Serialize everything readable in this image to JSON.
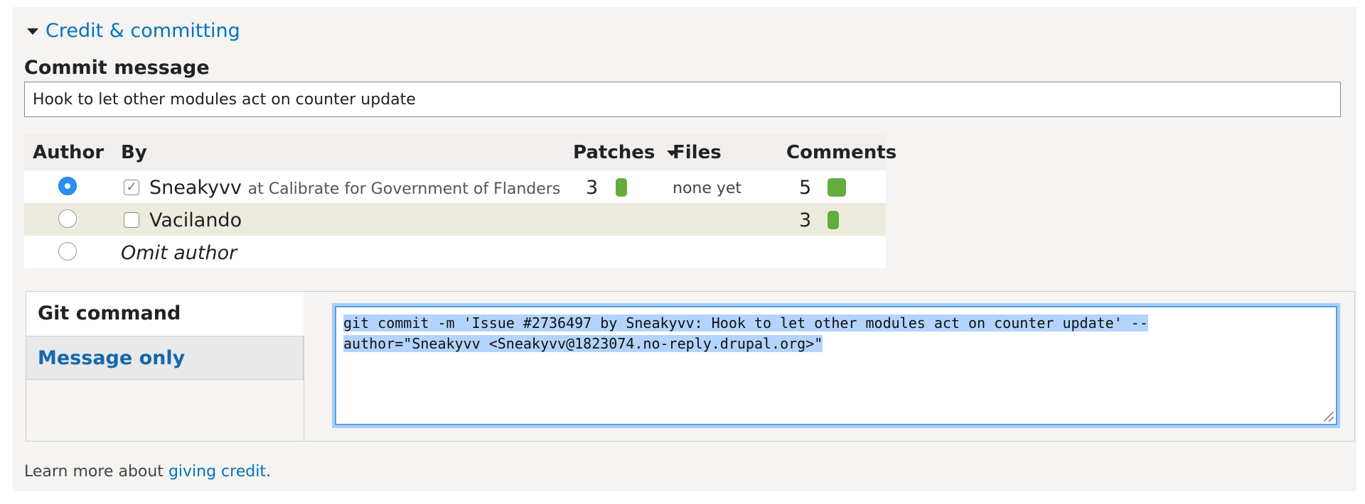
{
  "section": {
    "summary_label": "Credit & committing"
  },
  "commit_message": {
    "label": "Commit message",
    "value": "Hook to let other modules act on counter update"
  },
  "table": {
    "headers": {
      "author": "Author",
      "by": "By",
      "patches": "Patches",
      "files": "Files",
      "comments": "Comments"
    },
    "rows": [
      {
        "selected_author": true,
        "checked": true,
        "name": "Sneakyvv",
        "org": "at Calibrate for Government of Flanders",
        "patches": "3",
        "files": "none yet",
        "comments": "5"
      },
      {
        "selected_author": false,
        "checked": false,
        "name": "Vacilando",
        "org": "",
        "patches": "",
        "files": "",
        "comments": "3"
      }
    ],
    "omit_label": "Omit author"
  },
  "tabs": {
    "git_command": "Git command",
    "message_only": "Message only",
    "active": "git_command"
  },
  "git_command": {
    "line1": "git commit -m 'Issue #2736497 by Sneakyvv: Hook to let other modules act on counter update' --",
    "line2": "author=\"Sneakyvv <Sneakyvv@1823074.no-reply.drupal.org>\""
  },
  "footer": {
    "prefix": "Learn more about ",
    "link": "giving credit",
    "suffix": "."
  },
  "colors": {
    "link": "#0074bd",
    "bar_green": "#63ad3c",
    "selection": "#b3d4fc",
    "focus_ring": "#a9cdf4"
  },
  "icons": {
    "summary_toggle": "triangle-down-icon",
    "sort_indicator": "triangle-down-icon",
    "bar": "green-bar-icon",
    "resize": "resize-grip-icon"
  }
}
